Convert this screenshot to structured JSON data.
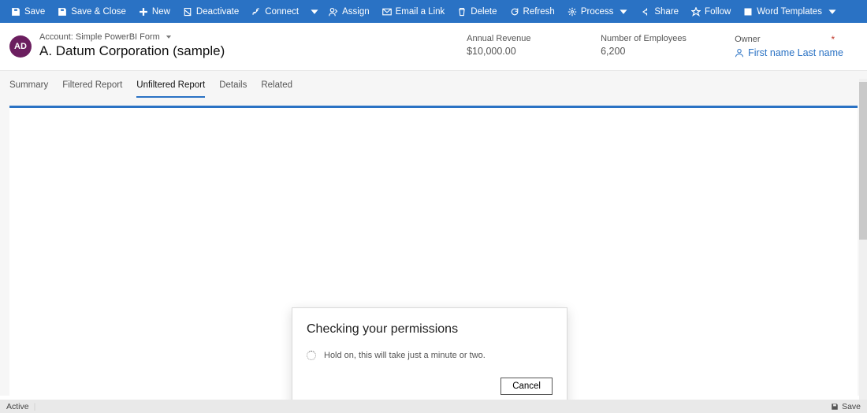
{
  "cmdbar": {
    "save": "Save",
    "save_close": "Save & Close",
    "new": "New",
    "deactivate": "Deactivate",
    "connect": "Connect",
    "assign": "Assign",
    "email_link": "Email a Link",
    "delete": "Delete",
    "refresh": "Refresh",
    "process": "Process",
    "share": "Share",
    "follow": "Follow",
    "word_templates": "Word Templates"
  },
  "avatar": "AD",
  "crumb": "Account: Simple PowerBI Form",
  "title": "A. Datum Corporation (sample)",
  "meta": {
    "revenue_label": "Annual Revenue",
    "revenue_value": "$10,000.00",
    "employees_label": "Number of Employees",
    "employees_value": "6,200",
    "owner_label": "Owner",
    "owner_value": "First name Last name",
    "required": "*"
  },
  "tabs": {
    "summary": "Summary",
    "filtered": "Filtered Report",
    "unfiltered": "Unfiltered Report",
    "details": "Details",
    "related": "Related"
  },
  "dialog": {
    "title": "Checking your permissions",
    "body": "Hold on, this will take just a minute or two.",
    "cancel": "Cancel"
  },
  "footer": {
    "status": "Active",
    "save": "Save"
  }
}
